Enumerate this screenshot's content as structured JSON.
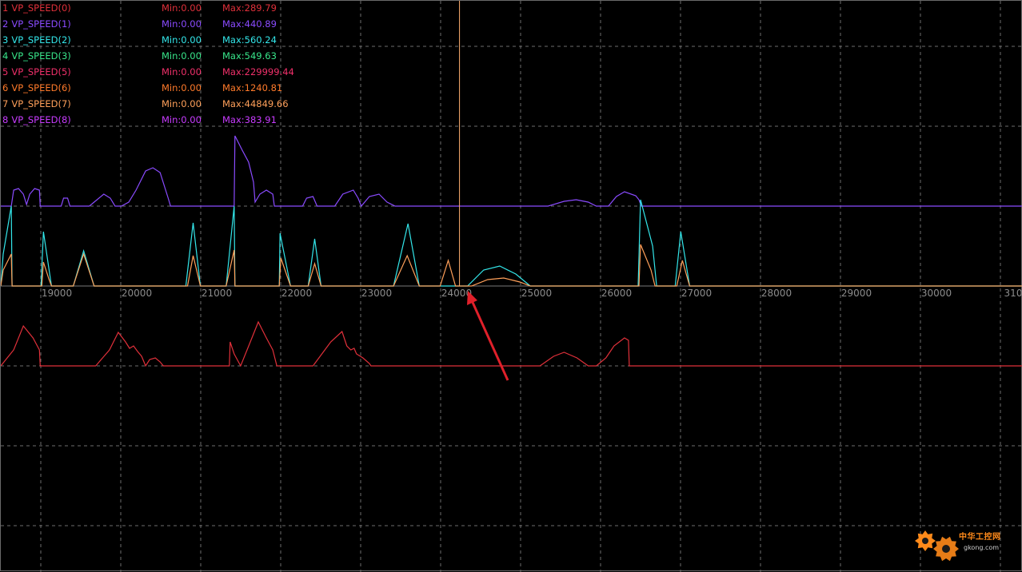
{
  "window": {
    "background": "#000000",
    "grid_color": "#6e6e6e",
    "axis_tick_color": "#8c8c8c"
  },
  "legend": [
    {
      "num": "1",
      "name": "VP_SPEED(0)",
      "min": "Min:0.00",
      "max": "Max:289.79",
      "color": "#e0303a"
    },
    {
      "num": "2",
      "name": "VP_SPEED(1)",
      "min": "Min:0.00",
      "max": "Max:440.89",
      "color": "#8a4bff"
    },
    {
      "num": "3",
      "name": "VP_SPEED(2)",
      "min": "Min:0.00",
      "max": "Max:560.24",
      "color": "#33e6ea"
    },
    {
      "num": "4",
      "name": "VP_SPEED(3)",
      "min": "Min:0.00",
      "max": "Max:549.63",
      "color": "#38e58a"
    },
    {
      "num": "5",
      "name": "VP_SPEED(5)",
      "min": "Min:0.00",
      "max": "Max:229999.44",
      "color": "#f0306a"
    },
    {
      "num": "6",
      "name": "VP_SPEED(6)",
      "min": "Min:0.00",
      "max": "Max:1240.81",
      "color": "#ff7a2a"
    },
    {
      "num": "7",
      "name": "VP_SPEED(7)",
      "min": "Min:0.00",
      "max": "Max:44849.66",
      "color": "#ffa05a"
    },
    {
      "num": "8",
      "name": "VP_SPEED(8)",
      "min": "Min:0.00",
      "max": "Max:383.91",
      "color": "#c83cff"
    }
  ],
  "axis": {
    "ticks": [
      "19000",
      "20000",
      "21000",
      "22000",
      "23000",
      "24000",
      "25000",
      "26000",
      "27000",
      "28000",
      "29000",
      "30000",
      "310"
    ]
  },
  "cursor": {
    "x_value": 24100,
    "color": "#ffb070"
  },
  "annotation": {
    "type": "arrow",
    "color": "#e0202a"
  },
  "watermark": {
    "text": "中华工控网",
    "url": "gkong.com",
    "gear_color": "#ff8a1a"
  },
  "chart_data": {
    "type": "line",
    "xlabel": "",
    "ylabel": "",
    "xlim": [
      18400,
      31100
    ],
    "grid": true,
    "series": [
      {
        "name": "VP_SPEED(1)",
        "color": "#8a4bff",
        "points": [
          [
            18400,
            0
          ],
          [
            18530,
            0
          ],
          [
            18560,
            0.2
          ],
          [
            18620,
            0.22
          ],
          [
            18680,
            0.15
          ],
          [
            18720,
            0.02
          ],
          [
            18760,
            0.15
          ],
          [
            18820,
            0.22
          ],
          [
            18880,
            0.2
          ],
          [
            18890,
            0
          ],
          [
            19150,
            0
          ],
          [
            19180,
            0.1
          ],
          [
            19230,
            0.1
          ],
          [
            19260,
            0
          ],
          [
            19500,
            0
          ],
          [
            19560,
            0.05
          ],
          [
            19680,
            0.15
          ],
          [
            19760,
            0.1
          ],
          [
            19820,
            0
          ],
          [
            19900,
            0
          ],
          [
            19990,
            0.05
          ],
          [
            20080,
            0.2
          ],
          [
            20200,
            0.44
          ],
          [
            20290,
            0.48
          ],
          [
            20380,
            0.42
          ],
          [
            20480,
            0.1
          ],
          [
            20510,
            0
          ],
          [
            21300,
            0
          ],
          [
            21310,
            0.88
          ],
          [
            21400,
            0.7
          ],
          [
            21480,
            0.55
          ],
          [
            21540,
            0.3
          ],
          [
            21560,
            0.05
          ],
          [
            21620,
            0.15
          ],
          [
            21700,
            0.2
          ],
          [
            21780,
            0.15
          ],
          [
            21800,
            0
          ],
          [
            22150,
            0
          ],
          [
            22200,
            0.1
          ],
          [
            22280,
            0.12
          ],
          [
            22330,
            0
          ],
          [
            22550,
            0
          ],
          [
            22650,
            0.15
          ],
          [
            22780,
            0.2
          ],
          [
            22840,
            0.1
          ],
          [
            22880,
            0
          ],
          [
            22980,
            0.12
          ],
          [
            23100,
            0.15
          ],
          [
            23200,
            0.05
          ],
          [
            23300,
            0
          ],
          [
            25200,
            0
          ],
          [
            25400,
            0.06
          ],
          [
            25550,
            0.08
          ],
          [
            25700,
            0.05
          ],
          [
            25800,
            0
          ],
          [
            25950,
            0
          ],
          [
            26050,
            0.12
          ],
          [
            26150,
            0.18
          ],
          [
            26290,
            0.13
          ],
          [
            26330,
            0.08
          ],
          [
            26360,
            0
          ],
          [
            31100,
            0
          ]
        ]
      },
      {
        "name": "VP_SPEED(2)",
        "color": "#33e6ea",
        "points": [
          [
            18400,
            0
          ],
          [
            18430,
            0.4
          ],
          [
            18530,
            1.0
          ],
          [
            18540,
            0
          ],
          [
            18900,
            0
          ],
          [
            18930,
            0.68
          ],
          [
            19000,
            0.2
          ],
          [
            19030,
            0
          ],
          [
            19300,
            0
          ],
          [
            19430,
            0.44
          ],
          [
            19560,
            0
          ],
          [
            20700,
            0
          ],
          [
            20790,
            0.79
          ],
          [
            20880,
            0
          ],
          [
            21200,
            0
          ],
          [
            21300,
            1.0
          ],
          [
            21310,
            0
          ],
          [
            21860,
            0
          ],
          [
            21870,
            0.66
          ],
          [
            22000,
            0
          ],
          [
            22220,
            0
          ],
          [
            22300,
            0.59
          ],
          [
            22380,
            0
          ],
          [
            23280,
            0
          ],
          [
            23460,
            0.78
          ],
          [
            23600,
            0
          ],
          [
            24200,
            0
          ],
          [
            24400,
            0.2
          ],
          [
            24600,
            0.25
          ],
          [
            24800,
            0.15
          ],
          [
            24980,
            0
          ],
          [
            26320,
            0
          ],
          [
            26350,
            1.08
          ],
          [
            26500,
            0.5
          ],
          [
            26550,
            0
          ],
          [
            26780,
            0
          ],
          [
            26850,
            0.68
          ],
          [
            26960,
            0
          ],
          [
            31100,
            0
          ]
        ]
      },
      {
        "name": "VP_SPEED(7)",
        "color": "#ffa05a",
        "points": [
          [
            18400,
            0
          ],
          [
            18430,
            0.2
          ],
          [
            18530,
            0.4
          ],
          [
            18540,
            0
          ],
          [
            18910,
            0
          ],
          [
            18930,
            0.3
          ],
          [
            19000,
            0.08
          ],
          [
            19030,
            0
          ],
          [
            19300,
            0
          ],
          [
            19430,
            0.4
          ],
          [
            19560,
            0
          ],
          [
            20720,
            0
          ],
          [
            20790,
            0.38
          ],
          [
            20880,
            0
          ],
          [
            21200,
            0
          ],
          [
            21300,
            0.45
          ],
          [
            21310,
            0
          ],
          [
            21860,
            0
          ],
          [
            21880,
            0.35
          ],
          [
            22000,
            0
          ],
          [
            22220,
            0
          ],
          [
            22300,
            0.28
          ],
          [
            22380,
            0
          ],
          [
            23280,
            0
          ],
          [
            23450,
            0.38
          ],
          [
            23600,
            0
          ],
          [
            23860,
            0
          ],
          [
            23960,
            0.32
          ],
          [
            24050,
            0
          ],
          [
            24250,
            0
          ],
          [
            24450,
            0.08
          ],
          [
            24650,
            0.1
          ],
          [
            24850,
            0.05
          ],
          [
            24980,
            0
          ],
          [
            26330,
            0
          ],
          [
            26350,
            0.52
          ],
          [
            26480,
            0.2
          ],
          [
            26530,
            0
          ],
          [
            26800,
            0
          ],
          [
            26870,
            0.32
          ],
          [
            26960,
            0
          ],
          [
            31100,
            0
          ]
        ]
      },
      {
        "name": "VP_SPEED(0)",
        "color": "#e0303a",
        "points": [
          [
            18400,
            0
          ],
          [
            18560,
            0.2
          ],
          [
            18680,
            0.5
          ],
          [
            18800,
            0.35
          ],
          [
            18880,
            0.2
          ],
          [
            18890,
            0
          ],
          [
            19250,
            0
          ],
          [
            19580,
            0
          ],
          [
            19750,
            0.2
          ],
          [
            19860,
            0.42
          ],
          [
            19950,
            0.3
          ],
          [
            20000,
            0.22
          ],
          [
            20050,
            0.25
          ],
          [
            20100,
            0.18
          ],
          [
            20150,
            0.12
          ],
          [
            20200,
            0
          ],
          [
            20250,
            0.08
          ],
          [
            20320,
            0.1
          ],
          [
            20380,
            0.05
          ],
          [
            20420,
            0
          ],
          [
            20480,
            0
          ],
          [
            21240,
            0
          ],
          [
            21250,
            0.3
          ],
          [
            21300,
            0.15
          ],
          [
            21380,
            0
          ],
          [
            21500,
            0.3
          ],
          [
            21600,
            0.55
          ],
          [
            21700,
            0.35
          ],
          [
            21780,
            0.2
          ],
          [
            21830,
            0
          ],
          [
            22280,
            0
          ],
          [
            22500,
            0.3
          ],
          [
            22640,
            0.43
          ],
          [
            22700,
            0.25
          ],
          [
            22750,
            0.2
          ],
          [
            22790,
            0.22
          ],
          [
            22820,
            0.15
          ],
          [
            22900,
            0.1
          ],
          [
            22980,
            0.03
          ],
          [
            23000,
            0
          ],
          [
            25100,
            0
          ],
          [
            25270,
            0.12
          ],
          [
            25400,
            0.17
          ],
          [
            25560,
            0.1
          ],
          [
            25700,
            0
          ],
          [
            25800,
            0
          ],
          [
            25920,
            0.1
          ],
          [
            26020,
            0.25
          ],
          [
            26150,
            0.35
          ],
          [
            26200,
            0.32
          ],
          [
            26210,
            0
          ],
          [
            31100,
            0
          ]
        ]
      }
    ]
  }
}
